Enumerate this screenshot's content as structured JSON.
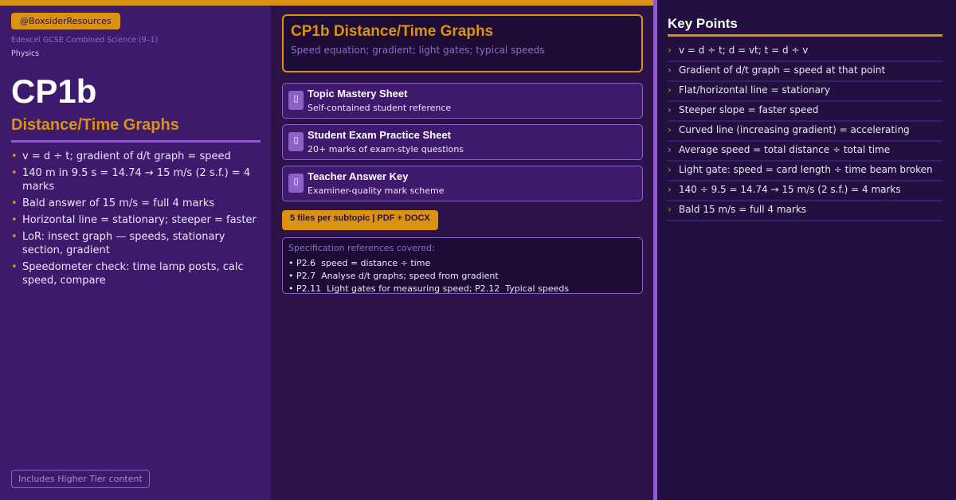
{
  "header_stripe_color": "#d99212",
  "left": {
    "handle": "@BoxsiderResources",
    "exam_board": "Edexcel GCSE Combined Science (9–1)",
    "subject": "Physics",
    "topic_code": "CP1b",
    "topic_title": "Distance/Time Graphs",
    "summary_points": [
      "v = d ÷ t; gradient of d/t graph = speed",
      "140 m in 9.5 s = 14.74 → 15 m/s (2 s.f.) = 4 marks",
      "Bald answer of 15 m/s = full 4 marks",
      "Horizontal line = stationary; steeper = faster",
      "LoR: insect graph — speeds, stationary section, gradient",
      "Speedometer check: time lamp posts, calc speed, compare"
    ],
    "tier_note": "Includes Higher Tier content"
  },
  "middle": {
    "title": "CP1b Distance/Time Graphs",
    "subtitle": "Speed equation; gradient; light gates; typical speeds",
    "resources": [
      {
        "icon": "document-icon",
        "title": "Topic Mastery Sheet",
        "description": "Self-contained student reference"
      },
      {
        "icon": "document-icon",
        "title": "Student Exam Practice Sheet",
        "description": "20+ marks of exam-style questions"
      },
      {
        "icon": "document-icon",
        "title": "Teacher Answer Key",
        "description": "Examiner-quality mark scheme"
      }
    ],
    "files_badge": "5 files per subtopic  |  PDF + DOCX",
    "spec_heading": "Specification references covered:",
    "spec_refs": [
      "• P2.6  speed = distance ÷ time",
      "• P2.7  Analyse d/t graphs; speed from gradient",
      "• P2.11  Light gates for measuring speed; P2.12  Typical speeds"
    ]
  },
  "right": {
    "heading": "Key Points",
    "points": [
      "v = d ÷ t; d = vt; t = d ÷ v",
      "Gradient of d/t graph = speed at that point",
      "Flat/horizontal line = stationary",
      "Steeper slope = faster speed",
      "Curved line (increasing gradient) = accelerating",
      "Average speed = total distance ÷ total time",
      "Light gate: speed = card length ÷ time beam broken",
      "140 ÷ 9.5 = 14.74 → 15 m/s (2 s.f.) = 4 marks",
      "Bald 15 m/s = full 4 marks"
    ]
  },
  "colors": {
    "accent_orange": "#d99212",
    "accent_purple": "#8d5cc9",
    "panel_left": "#3d1a6b",
    "panel_middle": "#2b1248",
    "panel_right": "#241040"
  }
}
